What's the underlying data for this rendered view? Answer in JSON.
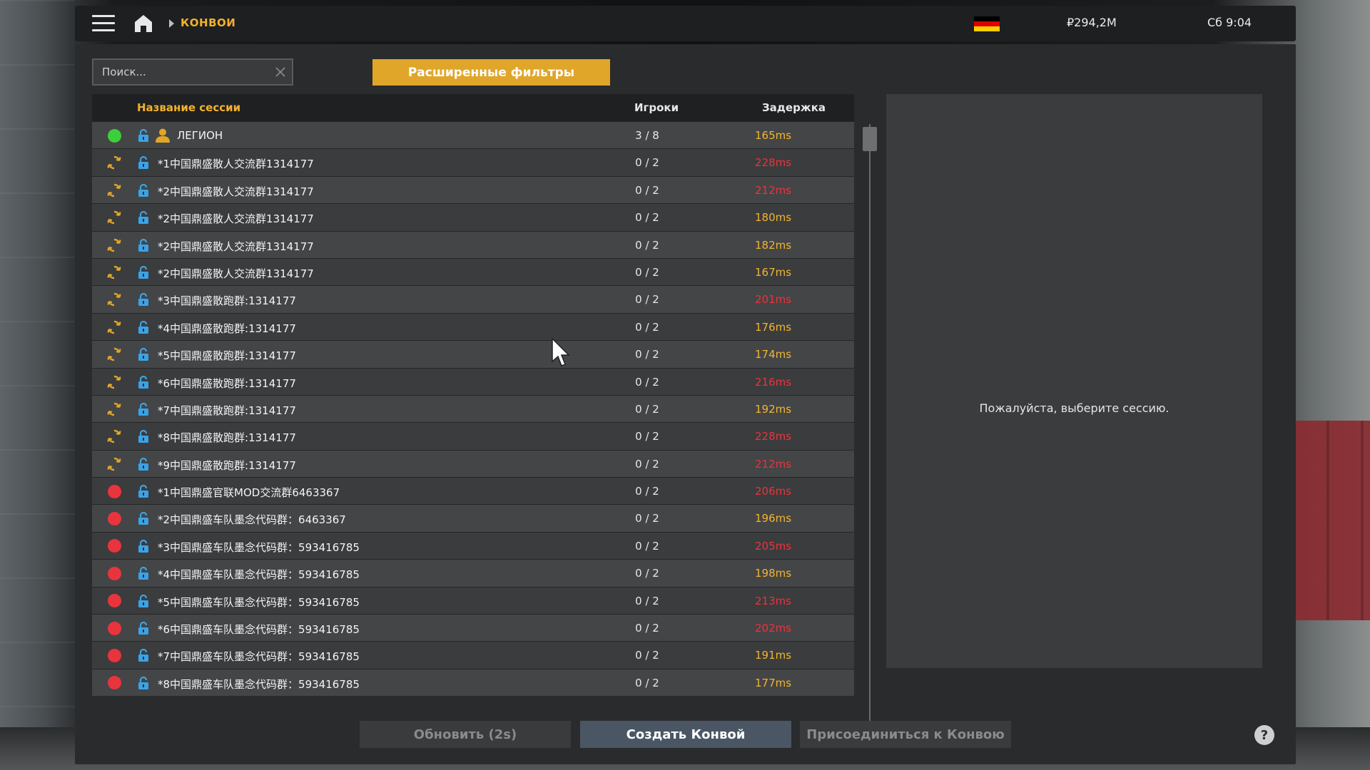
{
  "topbar": {
    "breadcrumb": "КОНВОИ",
    "money": "₽294,2M",
    "clock": "Сб 9:04",
    "flag_colors": [
      "#000000",
      "#dd0000",
      "#ffce00"
    ]
  },
  "search": {
    "placeholder": "Поиск..."
  },
  "filters_button": "Расширенные фильтры",
  "table": {
    "headers": {
      "name": "Название сессии",
      "players": "Игроки",
      "ping": "Задержка"
    },
    "rows": [
      {
        "status": "online",
        "host_icon": true,
        "name": "ЛЕГИОН",
        "players": "3 / 8",
        "ping": "165ms",
        "ping_level": "ok"
      },
      {
        "status": "loading",
        "host_icon": false,
        "name": "*1中国鼎盛散人交流群1314177",
        "players": "0 / 2",
        "ping": "228ms",
        "ping_level": "high"
      },
      {
        "status": "loading",
        "host_icon": false,
        "name": "*2中国鼎盛散人交流群1314177",
        "players": "0 / 2",
        "ping": "212ms",
        "ping_level": "high"
      },
      {
        "status": "loading",
        "host_icon": false,
        "name": "*2中国鼎盛散人交流群1314177",
        "players": "0 / 2",
        "ping": "180ms",
        "ping_level": "ok"
      },
      {
        "status": "loading",
        "host_icon": false,
        "name": "*2中国鼎盛散人交流群1314177",
        "players": "0 / 2",
        "ping": "182ms",
        "ping_level": "ok"
      },
      {
        "status": "loading",
        "host_icon": false,
        "name": "*2中国鼎盛散人交流群1314177",
        "players": "0 / 2",
        "ping": "167ms",
        "ping_level": "ok"
      },
      {
        "status": "loading",
        "host_icon": false,
        "name": "*3中国鼎盛散跑群:1314177",
        "players": "0 / 2",
        "ping": "201ms",
        "ping_level": "high"
      },
      {
        "status": "loading",
        "host_icon": false,
        "name": "*4中国鼎盛散跑群:1314177",
        "players": "0 / 2",
        "ping": "176ms",
        "ping_level": "ok"
      },
      {
        "status": "loading",
        "host_icon": false,
        "name": "*5中国鼎盛散跑群:1314177",
        "players": "0 / 2",
        "ping": "174ms",
        "ping_level": "ok"
      },
      {
        "status": "loading",
        "host_icon": false,
        "name": "*6中国鼎盛散跑群:1314177",
        "players": "0 / 2",
        "ping": "216ms",
        "ping_level": "high"
      },
      {
        "status": "loading",
        "host_icon": false,
        "name": "*7中国鼎盛散跑群:1314177",
        "players": "0 / 2",
        "ping": "192ms",
        "ping_level": "ok"
      },
      {
        "status": "loading",
        "host_icon": false,
        "name": "*8中国鼎盛散跑群:1314177",
        "players": "0 / 2",
        "ping": "228ms",
        "ping_level": "high"
      },
      {
        "status": "loading",
        "host_icon": false,
        "name": "*9中国鼎盛散跑群:1314177",
        "players": "0 / 2",
        "ping": "212ms",
        "ping_level": "high"
      },
      {
        "status": "offline",
        "host_icon": false,
        "name": "*1中国鼎盛官联MOD交流群6463367",
        "players": "0 / 2",
        "ping": "206ms",
        "ping_level": "high"
      },
      {
        "status": "offline",
        "host_icon": false,
        "name": "*2中国鼎盛车队墨念代码群：6463367",
        "players": "0 / 2",
        "ping": "196ms",
        "ping_level": "ok"
      },
      {
        "status": "offline",
        "host_icon": false,
        "name": "*3中国鼎盛车队墨念代码群：593416785",
        "players": "0 / 2",
        "ping": "205ms",
        "ping_level": "high"
      },
      {
        "status": "offline",
        "host_icon": false,
        "name": "*4中国鼎盛车队墨念代码群：593416785",
        "players": "0 / 2",
        "ping": "198ms",
        "ping_level": "ok"
      },
      {
        "status": "offline",
        "host_icon": false,
        "name": "*5中国鼎盛车队墨念代码群：593416785",
        "players": "0 / 2",
        "ping": "213ms",
        "ping_level": "high"
      },
      {
        "status": "offline",
        "host_icon": false,
        "name": "*6中国鼎盛车队墨念代码群：593416785",
        "players": "0 / 2",
        "ping": "202ms",
        "ping_level": "high"
      },
      {
        "status": "offline",
        "host_icon": false,
        "name": "*7中国鼎盛车队墨念代码群：593416785",
        "players": "0 / 2",
        "ping": "191ms",
        "ping_level": "ok"
      },
      {
        "status": "offline",
        "host_icon": false,
        "name": "*8中国鼎盛车队墨念代码群：593416785",
        "players": "0 / 2",
        "ping": "177ms",
        "ping_level": "ok"
      }
    ]
  },
  "detail": {
    "message": "Пожалуйста, выберите сессию."
  },
  "buttons": {
    "refresh": "Обновить (2s)",
    "create": "Создать Конвой",
    "join": "Присоединиться к Конвою",
    "help": "?"
  },
  "colors": {
    "accent": "#e0a62a",
    "status_online": "#3ccf3c",
    "status_loading": "#e0a62a",
    "status_offline": "#e8343d",
    "lock": "#3aa3e6",
    "ping_ok": "#f1b530",
    "ping_high": "#e8343d"
  },
  "icons": {
    "menu": "hamburger-icon",
    "home": "home-icon",
    "lock": "lock-icon",
    "host": "user-icon",
    "loading": "refresh-icon",
    "clear": "close-icon",
    "help": "help-icon"
  }
}
